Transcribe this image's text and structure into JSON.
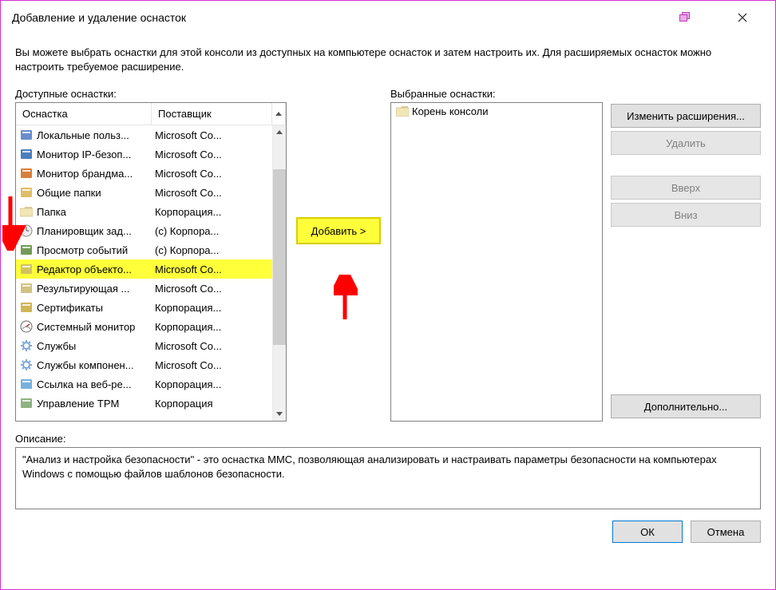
{
  "title": "Добавление и удаление оснасток",
  "intro": "Вы можете выбрать оснастки для этой консоли из доступных на компьютере оснасток и затем настроить их. Для расширяемых оснасток можно настроить требуемое расширение.",
  "labels": {
    "available": "Доступные оснастки:",
    "selected": "Выбранные оснастки:",
    "description": "Описание:"
  },
  "columns": {
    "snapin": "Оснастка",
    "vendor": "Поставщик"
  },
  "available": [
    {
      "name": "Локальные польз...",
      "vendor": "Microsoft Co...",
      "icon": "users"
    },
    {
      "name": "Монитор IP-безоп...",
      "vendor": "Microsoft Co...",
      "icon": "ipsec"
    },
    {
      "name": "Монитор брандма...",
      "vendor": "Microsoft Co...",
      "icon": "firewall"
    },
    {
      "name": "Общие папки",
      "vendor": "Microsoft Co...",
      "icon": "shared"
    },
    {
      "name": "Папка",
      "vendor": "Корпорация...",
      "icon": "folder"
    },
    {
      "name": "Планировщик зад...",
      "vendor": "(с) Корпора...",
      "icon": "clock"
    },
    {
      "name": "Просмотр событий",
      "vendor": "(с) Корпора...",
      "icon": "events"
    },
    {
      "name": "Редактор объекто...",
      "vendor": "Microsoft Co...",
      "icon": "gpedit",
      "selected": true
    },
    {
      "name": "Результирующая ...",
      "vendor": "Microsoft Co...",
      "icon": "result"
    },
    {
      "name": "Сертификаты",
      "vendor": "Корпорация...",
      "icon": "cert"
    },
    {
      "name": "Системный монитор",
      "vendor": "Корпорация...",
      "icon": "perfmon"
    },
    {
      "name": "Службы",
      "vendor": "Microsoft Co...",
      "icon": "services"
    },
    {
      "name": "Службы компонен...",
      "vendor": "Microsoft Co...",
      "icon": "comsvc"
    },
    {
      "name": "Ссылка на веб-ре...",
      "vendor": "Корпорация...",
      "icon": "weblink"
    },
    {
      "name": "Управление TPM",
      "vendor": "Корпорация",
      "icon": "tpm"
    }
  ],
  "selected": {
    "root": "Корень консоли"
  },
  "buttons": {
    "add": "Добавить >",
    "edit_ext": "Изменить расширения...",
    "remove": "Удалить",
    "up": "Вверх",
    "down": "Вниз",
    "advanced": "Дополнительно...",
    "ok": "ОК",
    "cancel": "Отмена"
  },
  "description_text": "\"Анализ и настройка безопасности\" - это оснастка MMC, позволяющая анализировать и настраивать параметры безопасности на компьютерах Windows с помощью файлов шаблонов безопасности."
}
